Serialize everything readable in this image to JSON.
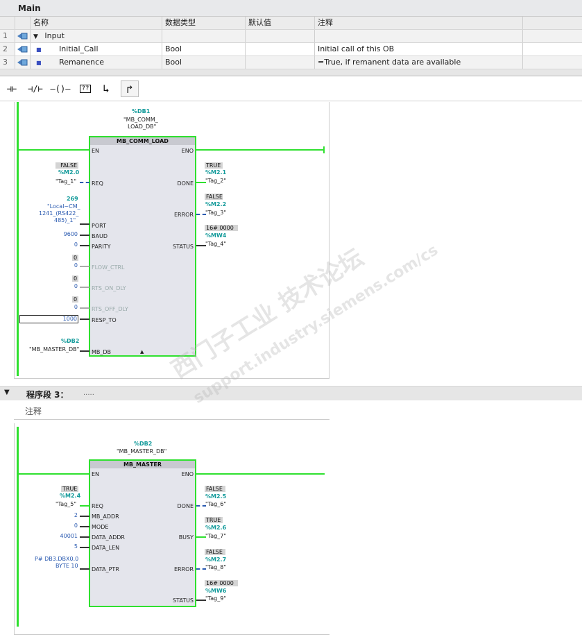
{
  "table": {
    "title": "Main",
    "headers": [
      "名称",
      "数据类型",
      "默认值",
      "注释"
    ],
    "rows": [
      {
        "num": "1",
        "name": "Input",
        "type": "",
        "comment": ""
      },
      {
        "num": "2",
        "name": "Initial_Call",
        "type": "Bool",
        "comment": "Initial call of this OB"
      },
      {
        "num": "3",
        "name": "Remanence",
        "type": "Bool",
        "comment": "=True, if remanent data are available"
      }
    ]
  },
  "toolbar": {
    "buttons": [
      {
        "name": "no-contact-button",
        "glyph": "⊣⊢"
      },
      {
        "name": "nc-contact-button",
        "glyph": "⊣/⊢"
      },
      {
        "name": "coil-button",
        "glyph": "–()–"
      },
      {
        "name": "empty-box-button",
        "glyph": "??"
      },
      {
        "name": "open-branch-button",
        "glyph": "↳"
      },
      {
        "name": "close-branch-button",
        "glyph": "↱"
      }
    ]
  },
  "network2": {
    "db_addr": "%DB1",
    "db_name1": "\"MB_COMM_",
    "db_name2": "LOAD_DB\"",
    "block_title": "MB_COMM_LOAD",
    "pin_en": "EN",
    "pin_eno": "ENO",
    "req_state": "FALSE",
    "req_addr": "%M2.0",
    "req_tag": "\"Tag_1\"",
    "pin_req": "REQ",
    "port_value": "269",
    "port_tag1": "\"Local~CM_",
    "port_tag2": "1241_(RS422_",
    "port_tag3": "485)_1\"",
    "pin_port": "PORT",
    "baud_value": "9600",
    "pin_baud": "BAUD",
    "parity_value": "0",
    "pin_parity": "PARITY",
    "flow_grey": "0",
    "flow_value": "0",
    "pin_flow": "FLOW_CTRL",
    "rtson_grey": "0",
    "rtson_value": "0",
    "pin_rtson": "RTS_ON_DLY",
    "rtsoff_grey": "0",
    "rtsoff_value": "0",
    "pin_rtsoff": "RTS_OFF_DLY",
    "resp_value": "1000",
    "pin_resp": "RESP_TO",
    "mbdb_addr": "%DB2",
    "mbdb_tag": "\"MB_MASTER_DB\"",
    "pin_mbdb": "MB_DB",
    "pin_done": "DONE",
    "done_state": "TRUE",
    "done_addr": "%M2.1",
    "done_tag": "\"Tag_2\"",
    "pin_error": "ERROR",
    "error_state": "FALSE",
    "error_addr": "%M2.2",
    "error_tag": "\"Tag_3\"",
    "pin_status": "STATUS",
    "status_value": "16# 0000",
    "status_addr": "%MW4",
    "status_tag": "\"Tag_4\""
  },
  "network3": {
    "header": "程序段 3：",
    "header_dots": ".....",
    "comment": "注释",
    "db_addr": "%DB2",
    "db_name": "\"MB_MASTER_DB\"",
    "block_title": "MB_MASTER",
    "pin_en": "EN",
    "pin_eno": "ENO",
    "req_state": "TRUE",
    "req_addr": "%M2.4",
    "req_tag": "\"Tag_5\"",
    "pin_req": "REQ",
    "addr_value": "2",
    "pin_addr": "MB_ADDR",
    "mode_value": "0",
    "pin_mode": "MODE",
    "daddr_value": "40001",
    "pin_daddr": "DATA_ADDR",
    "dlen_value": "5",
    "pin_dlen": "DATA_LEN",
    "dptr_value1": "P# DB3.DBX0.0",
    "dptr_value2": "BYTE 10",
    "pin_dptr": "DATA_PTR",
    "pin_done": "DONE",
    "done_state": "FALSE",
    "done_addr": "%M2.5",
    "done_tag": "\"Tag_6\"",
    "pin_busy": "BUSY",
    "busy_state": "TRUE",
    "busy_addr": "%M2.6",
    "busy_tag": "\"Tag_7\"",
    "pin_error": "ERROR",
    "error_state": "FALSE",
    "error_addr": "%M2.7",
    "error_tag": "\"Tag_8\"",
    "pin_status": "STATUS",
    "status_value": "16# 0000",
    "status_addr": "%MW6",
    "status_tag": "\"Tag_9\""
  },
  "watermark": {
    "line1": "西门子工业  技术论坛",
    "line2": "support.industry.siemens.com/cs"
  }
}
